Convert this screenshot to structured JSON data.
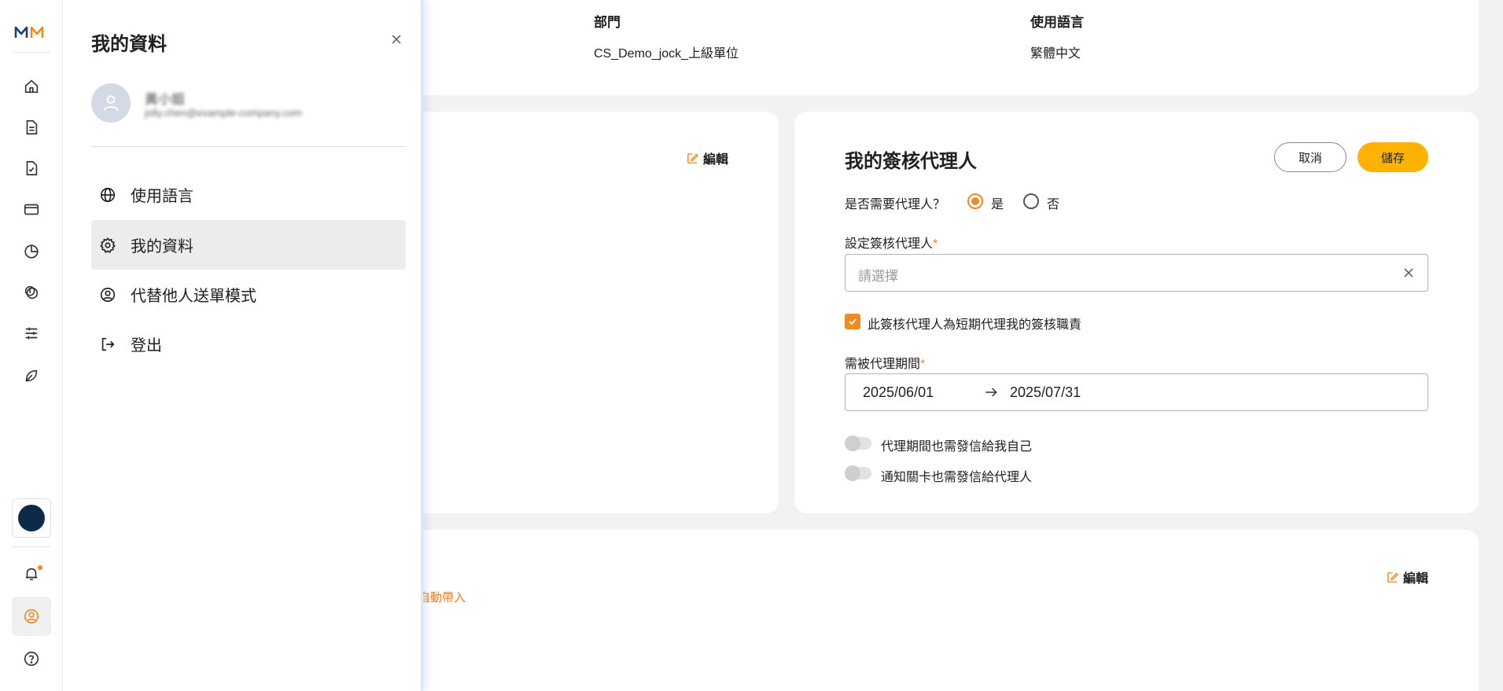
{
  "rail": {
    "logo": "mm-logo",
    "icons": [
      "home-icon",
      "document-icon",
      "document-sign-icon",
      "wallet-icon",
      "pie-chart-icon",
      "coin-icon",
      "sliders-icon",
      "leaf-icon"
    ],
    "bottom_icons": [
      "org-avatar",
      "bell-icon",
      "user-circle-icon",
      "help-icon"
    ]
  },
  "profile": {
    "department_label": "部門",
    "department_value": "CS_Demo_jock_上級單位",
    "language_label": "使用語言",
    "language_value": "繁體中文"
  },
  "left_card": {
    "edit_label": "編輯"
  },
  "proxy": {
    "title": "我的簽核代理人",
    "cancel_label": "取消",
    "save_label": "儲存",
    "need_proxy_question": "是否需要代理人？",
    "option_yes": "是",
    "option_no": "否",
    "selected_option": "是",
    "set_proxy_label": "設定簽核代理人",
    "required_mark": "*",
    "select_placeholder": "請選擇",
    "short_term_label": "此簽核代理人為短期代理我的簽核職責",
    "short_term_checked": true,
    "period_label": "需被代理期間",
    "start_date": "2025/06/01",
    "end_date": "2025/07/31",
    "toggle_self_label": "代理期間也需發信給我自己",
    "toggle_self_on": false,
    "toggle_proxy_label": "通知關卡也需發信給代理人",
    "toggle_proxy_on": false
  },
  "bottom_card": {
    "edit_label": "編輯",
    "orange_note": "自動帶入"
  },
  "drawer": {
    "title": "我的資料",
    "user_name": "黃小姐",
    "user_email": "jolly.chen@example-company.com",
    "menu": [
      {
        "label": "使用語言",
        "icon": "globe-icon"
      },
      {
        "label": "我的資料",
        "icon": "gear-icon",
        "active": true
      },
      {
        "label": "代替他人送單模式",
        "icon": "user-switch-icon"
      },
      {
        "label": "登出",
        "icon": "logout-icon"
      }
    ]
  },
  "colors": {
    "accent": "#f08a24",
    "save_button": "#ffb300",
    "background": "#f2f2f2"
  }
}
